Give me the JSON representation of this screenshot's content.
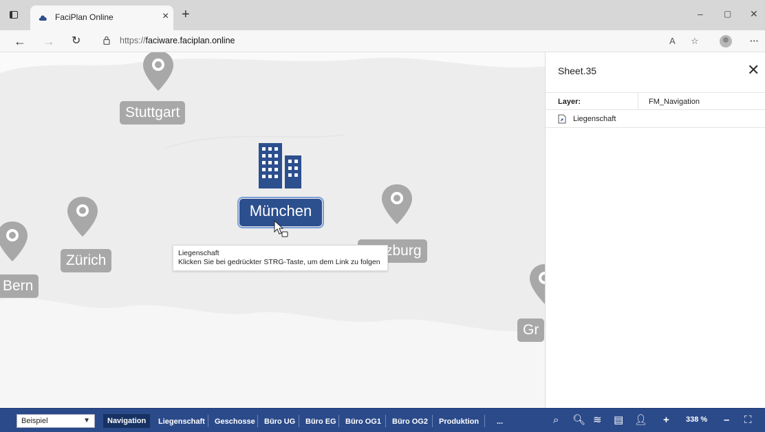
{
  "browser": {
    "tab_title": "FaciPlan Online",
    "url_scheme": "https://",
    "url_host": "faciware.faciplan.online"
  },
  "map": {
    "cities": [
      {
        "name": "Stuttgart"
      },
      {
        "name": "Zürich"
      },
      {
        "name": "Bern"
      },
      {
        "name": "zburg"
      },
      {
        "name": "Gr"
      }
    ],
    "selected_city": "München",
    "tooltip": {
      "line1": "Liegenschaft",
      "line2": "Klicken Sie bei gedrückter STRG-Taste, um dem Link zu folgen"
    }
  },
  "panel": {
    "title": "Sheet.35",
    "layer_label": "Layer:",
    "layer_value": "FM_Navigation",
    "link_label": "Liegenschaft"
  },
  "toolbar": {
    "select_value": "Beispiel",
    "tabs": [
      "Navigation",
      "Liegenschaft",
      "Geschosse",
      "Büro UG",
      "Büro EG",
      "Büro OG1",
      "Büro OG2",
      "Produktion",
      "..."
    ],
    "active_tab": "Navigation",
    "zoom": "338 %"
  },
  "colors": {
    "toolbar": "#2b4a8a",
    "selected_city": "#2c4f8e",
    "city_label": "#a8a8a8"
  }
}
